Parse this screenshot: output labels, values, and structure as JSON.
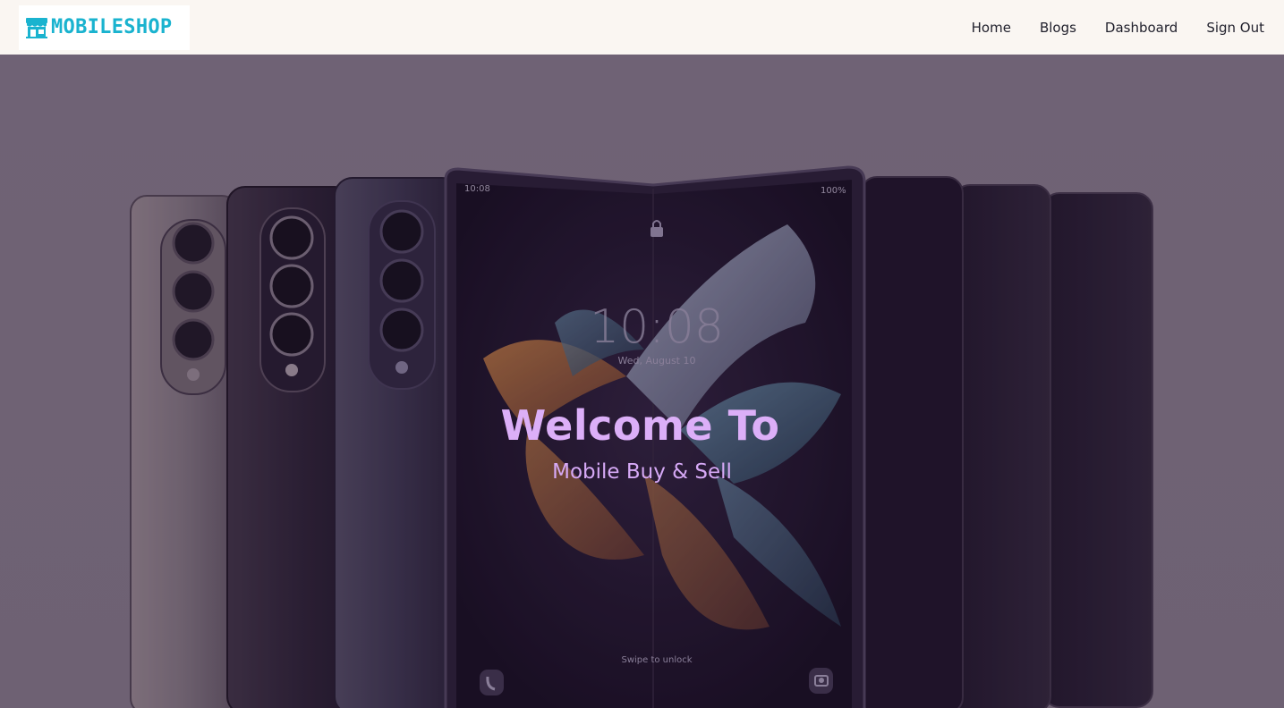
{
  "navbar": {
    "logo_text": "MOBILESHOP",
    "logo_icon": "store-icon",
    "links": [
      {
        "label": "Home"
      },
      {
        "label": "Blogs"
      },
      {
        "label": "Dashboard"
      },
      {
        "label": "Sign Out"
      }
    ]
  },
  "hero": {
    "title": "Welcome To",
    "subtitle": "Mobile Buy & Sell"
  },
  "phone_screen": {
    "status_time": "10:08",
    "status_battery": "100%",
    "clock": "10:08",
    "date": "Wed, August 10",
    "unlock_hint": "Swipe to unlock"
  },
  "colors": {
    "brand": "#1ab3cf",
    "navbar_bg": "#faf6f2",
    "hero_bg": "#7a6f7e",
    "hero_text": "#dcaff8"
  }
}
